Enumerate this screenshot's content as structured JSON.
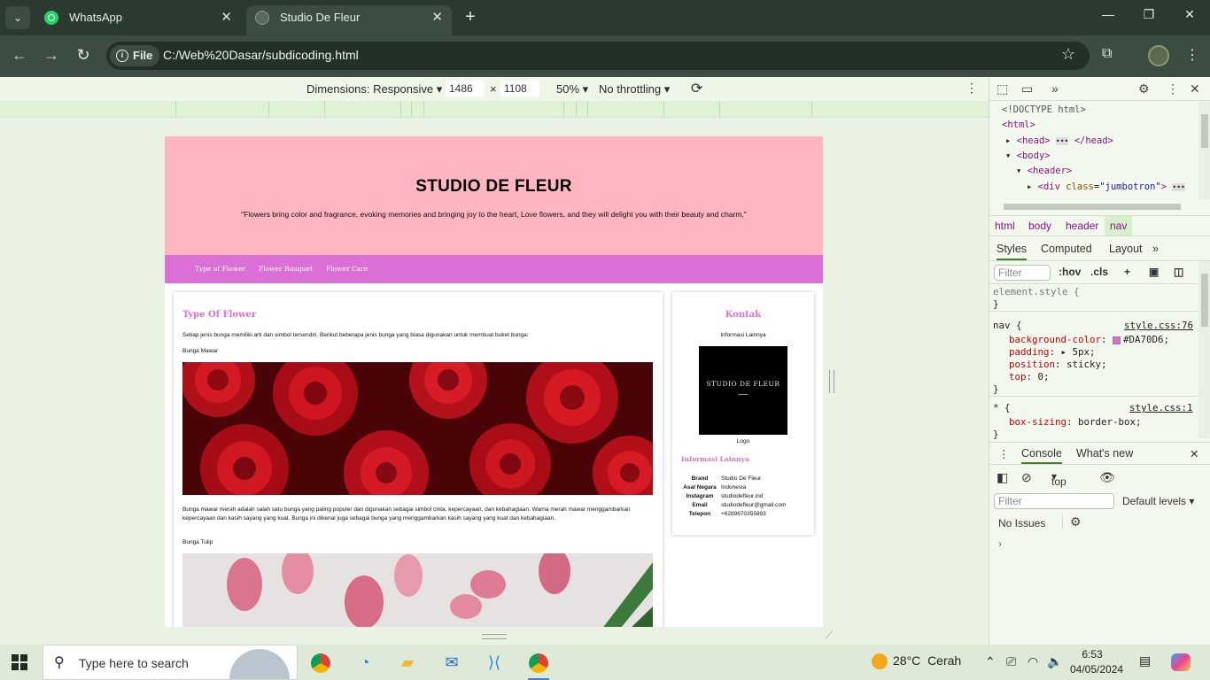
{
  "browser": {
    "tabs": [
      {
        "title": "WhatsApp",
        "active": false
      },
      {
        "title": "Studio De Fleur",
        "active": true
      }
    ],
    "address": {
      "scheme_chip": "File",
      "url": "C:/Web%20Dasar/subdicoding.html"
    }
  },
  "device_toolbar": {
    "dimensions_label": "Dimensions: Responsive",
    "width": "1486",
    "height": "1108",
    "times": "×",
    "zoom": "50%",
    "throttling": "No throttling"
  },
  "page": {
    "title": "STUDIO DE FLEUR",
    "quote": "\"Flowers bring color and fragrance, evoking memories and bringing joy to the heart, Love flowers, and they will delight you with their beauty and charm,\"",
    "nav": [
      "Type of Flower",
      "Flower Bouquet",
      "Flower Care"
    ],
    "main": {
      "heading": "Type Of Flower",
      "intro": "Setiap jenis bunga memiliki arti dan simbol tersendiri. Berikut beberapa jenis bunga yang biasa digunakan untuk membuat buket bunga:",
      "rose_label": "Bunga Mawar",
      "rose_desc": "Bunga mawar merah adalah salah satu bunga yang paling populer dan digunakan sebagai simbol cinta, kepercayaan, dan kebahagiaan. Warna merah mawar menggambarkan kepercayaan dan kasih sayang yang kuat. Bunga ini dikenal juga sebagai bunga yang menggambarkan kasih sayang yang kuat dan kebahagiaan.",
      "tulip_label": "Bunga Tulip"
    },
    "aside": {
      "heading": "Kontak",
      "sub": "Informasi Lainnya",
      "logo_text": "STUDIO DE FLEUR",
      "logo_caption": "Logo",
      "info_heading": "Informasi Lainnya",
      "info": [
        {
          "key": "Brand",
          "value": "Studio De Fleur"
        },
        {
          "key": "Asal Negara",
          "value": "Indonesia"
        },
        {
          "key": "Instagram",
          "value": "studiodefleur.ind"
        },
        {
          "key": "Email",
          "value": "studiodefleur@gmail.com"
        },
        {
          "key": "Telepon",
          "value": "+6289670355893"
        }
      ]
    }
  },
  "devtools": {
    "dom": {
      "doctype": "<!DOCTYPE html>",
      "html_open": "<html>",
      "head": "<head>",
      "head_close": "</head>",
      "body": "<body>",
      "header": "<header>",
      "div_tag": "<div",
      "div_attr": "class",
      "div_val": "\"jumbotron\"",
      "div_close": ">"
    },
    "breadcrumbs": [
      "html",
      "body",
      "header",
      "nav"
    ],
    "style_tabs": [
      "Styles",
      "Computed",
      "Layout"
    ],
    "filter_placeholder": "Filter",
    "hov": ":hov",
    "cls": ".cls",
    "rules": {
      "element_style": "element.style {",
      "close": "}",
      "nav_selector": "nav {",
      "nav_source": "style.css:76",
      "nav_props": [
        {
          "prop": "background-color",
          "value": "#DA70D6"
        },
        {
          "prop": "padding",
          "value": "5px"
        },
        {
          "prop": "position",
          "value": "sticky"
        },
        {
          "prop": "top",
          "value": "0"
        }
      ],
      "star_selector": "* {",
      "star_source": "style.css:1",
      "star_props": [
        {
          "prop": "box-sizing",
          "value": "border-box"
        }
      ]
    },
    "console_tabs": [
      "Console",
      "What's new"
    ],
    "console_context": "top",
    "console_filter": "Filter",
    "levels": "Default levels",
    "issues": "No Issues",
    "prompt": "›"
  },
  "taskbar": {
    "search_placeholder": "Type here to search",
    "weather_temp": "28°C",
    "weather_desc": "Cerah",
    "time": "6:53",
    "date": "04/05/2024"
  },
  "colors": {
    "header_pink": "#FFB6C1",
    "nav_orchid": "#DA70D6"
  }
}
